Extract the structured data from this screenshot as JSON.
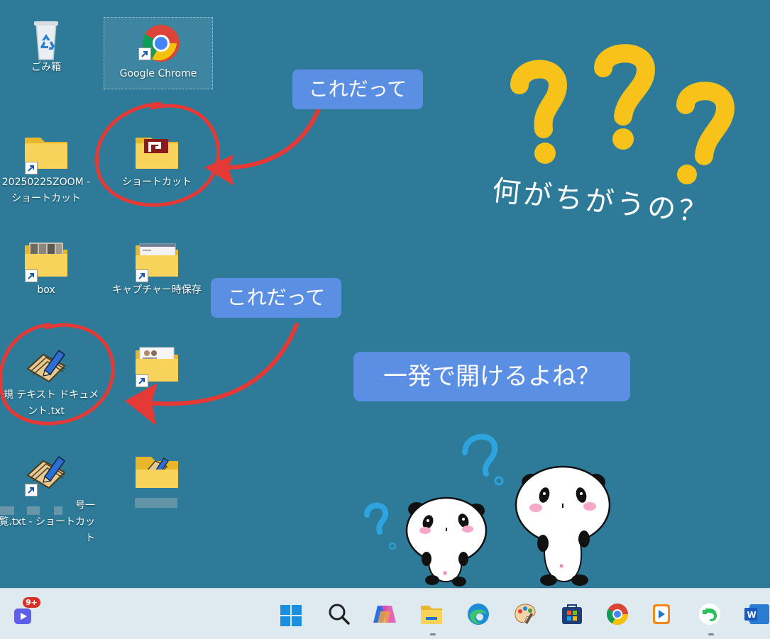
{
  "desktop": {
    "icons": [
      {
        "label": "ごみ箱"
      },
      {
        "label": "Google Chrome"
      },
      {
        "label": "20250225ZOOM -\nショートカット"
      },
      {
        "label": "ショートカット"
      },
      {
        "label": "box"
      },
      {
        "label": "キャプチャー時保存"
      },
      {
        "label": "新規 テキスト ドキュメ\nント.txt"
      },
      {
        "label": ""
      },
      {
        "label": "号一\n覧.txt - ショートカット"
      },
      {
        "label": ""
      }
    ]
  },
  "annotations": {
    "callout_1": "これだって",
    "callout_2": "これだって",
    "callout_3": "一発で開けるよね？",
    "handwritten_question": "何がちがうの？"
  },
  "taskbar": {
    "items": [
      {
        "name": "notification-app",
        "badge": "9+"
      },
      {
        "name": "start"
      },
      {
        "name": "search"
      },
      {
        "name": "copilot"
      },
      {
        "name": "file-explorer"
      },
      {
        "name": "edge"
      },
      {
        "name": "paint"
      },
      {
        "name": "store"
      },
      {
        "name": "chrome"
      },
      {
        "name": "media"
      },
      {
        "name": "evernote"
      },
      {
        "name": "word"
      }
    ]
  },
  "colors": {
    "desktop_bg": "#2d7b98",
    "callout_bg": "#5b8fe4",
    "annotation_red": "#e53935",
    "question_yellow": "#f7c21a",
    "taskbar_bg": "#dfeaf0"
  }
}
